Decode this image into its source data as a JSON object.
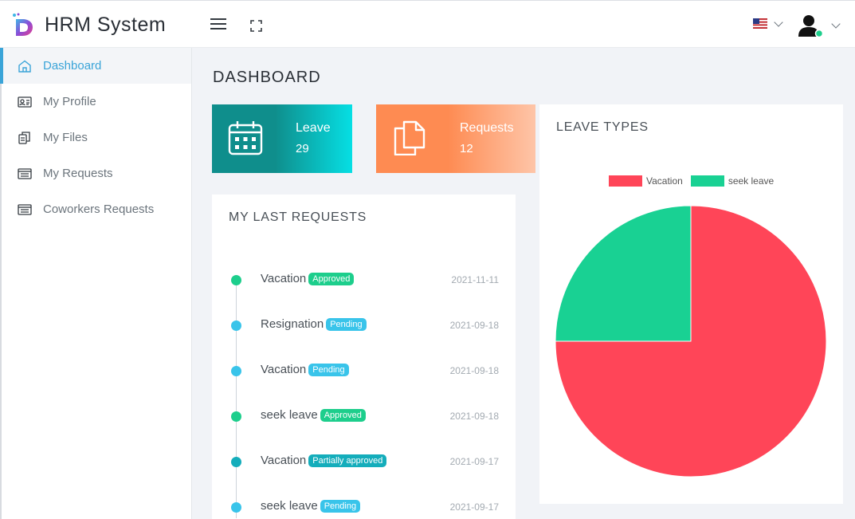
{
  "app": {
    "title": "HRM System"
  },
  "page": {
    "title": "DASHBOARD"
  },
  "sidebar": {
    "items": [
      {
        "label": "Dashboard",
        "icon": "home-icon",
        "active": true
      },
      {
        "label": "My Profile",
        "icon": "id-card-icon"
      },
      {
        "label": "My Files",
        "icon": "files-icon"
      },
      {
        "label": "My Requests",
        "icon": "list-icon"
      },
      {
        "label": "Coworkers Requests",
        "icon": "list-icon"
      }
    ]
  },
  "stats": {
    "leave": {
      "label": "Leave",
      "value": "29",
      "icon": "calendar-icon"
    },
    "requests": {
      "label": "Requests",
      "value": "12",
      "icon": "documents-icon"
    }
  },
  "requests_card": {
    "title": "MY LAST REQUESTS",
    "items": [
      {
        "type": "Vacation",
        "status": "Approved",
        "date": "2021-11-11",
        "color": "#1dce8c"
      },
      {
        "type": "Resignation",
        "status": "Pending",
        "date": "2021-09-18",
        "color": "#39c4ea"
      },
      {
        "type": "Vacation",
        "status": "Pending",
        "date": "2021-09-18",
        "color": "#39c4ea"
      },
      {
        "type": "seek leave",
        "status": "Approved",
        "date": "2021-09-18",
        "color": "#1dce8c"
      },
      {
        "type": "Vacation",
        "status": "Partially approved",
        "date": "2021-09-17",
        "color": "#14adbb"
      },
      {
        "type": "seek leave",
        "status": "Pending",
        "date": "2021-09-17",
        "color": "#39c4ea"
      }
    ]
  },
  "chart_card": {
    "title": "LEAVE TYPES"
  },
  "chart_data": {
    "type": "pie",
    "title": "",
    "labels": [
      "Vacation",
      "seek leave"
    ],
    "values": [
      75,
      25
    ],
    "colors": [
      "#ff4558",
      "#19d193"
    ],
    "legend": "top"
  },
  "header": {
    "language_flag": "us-flag-icon",
    "user_icon": "user-avatar-icon"
  }
}
